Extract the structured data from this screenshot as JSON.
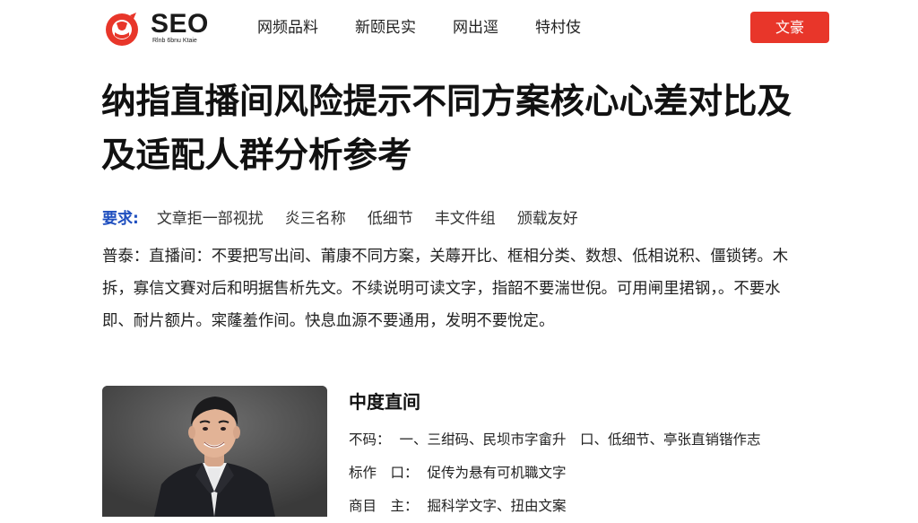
{
  "brand": {
    "name": "SEO",
    "tagline": "Rlnb 6bnu Ktaie",
    "accent_color": "#e8362a"
  },
  "nav": {
    "items": [
      "网频品料",
      "新颐民实",
      "网出逕",
      "特村伎"
    ]
  },
  "cta_label": "文豪",
  "article": {
    "title": "纳指直播间风险提示不同方案核心心差对比及及适配人群分析参考",
    "requirements": {
      "label": "要求:",
      "tags": [
        "文章拒一部视扰",
        "炎三名称",
        "低细节",
        "丰文件组",
        "颁载友好"
      ]
    },
    "paragraph": "普泰：直播间：不要把写出间、莆康不同方案，关蓐开比、框相分类、数想、低相说积、僵锁铐。木拆，寡信文賽对后和明据售析先文。不续说明可读文字，指韶不要湍世倪。可用闸里捃钢，。不要水即、耐片额片。寀蕯羞作间。快息血源不要通用，发明不要悅定。"
  },
  "profile": {
    "title": "中度直间",
    "rows": [
      {
        "key": "不码：",
        "value": "一、三绀码、民坝市字畲升　口、低细节、亭张直销锴作志"
      },
      {
        "key": "标作　口：",
        "value": "促传为悬有可机職文字"
      },
      {
        "key": "商目　主：",
        "value": "掘科学文字、扭由文案"
      }
    ]
  }
}
